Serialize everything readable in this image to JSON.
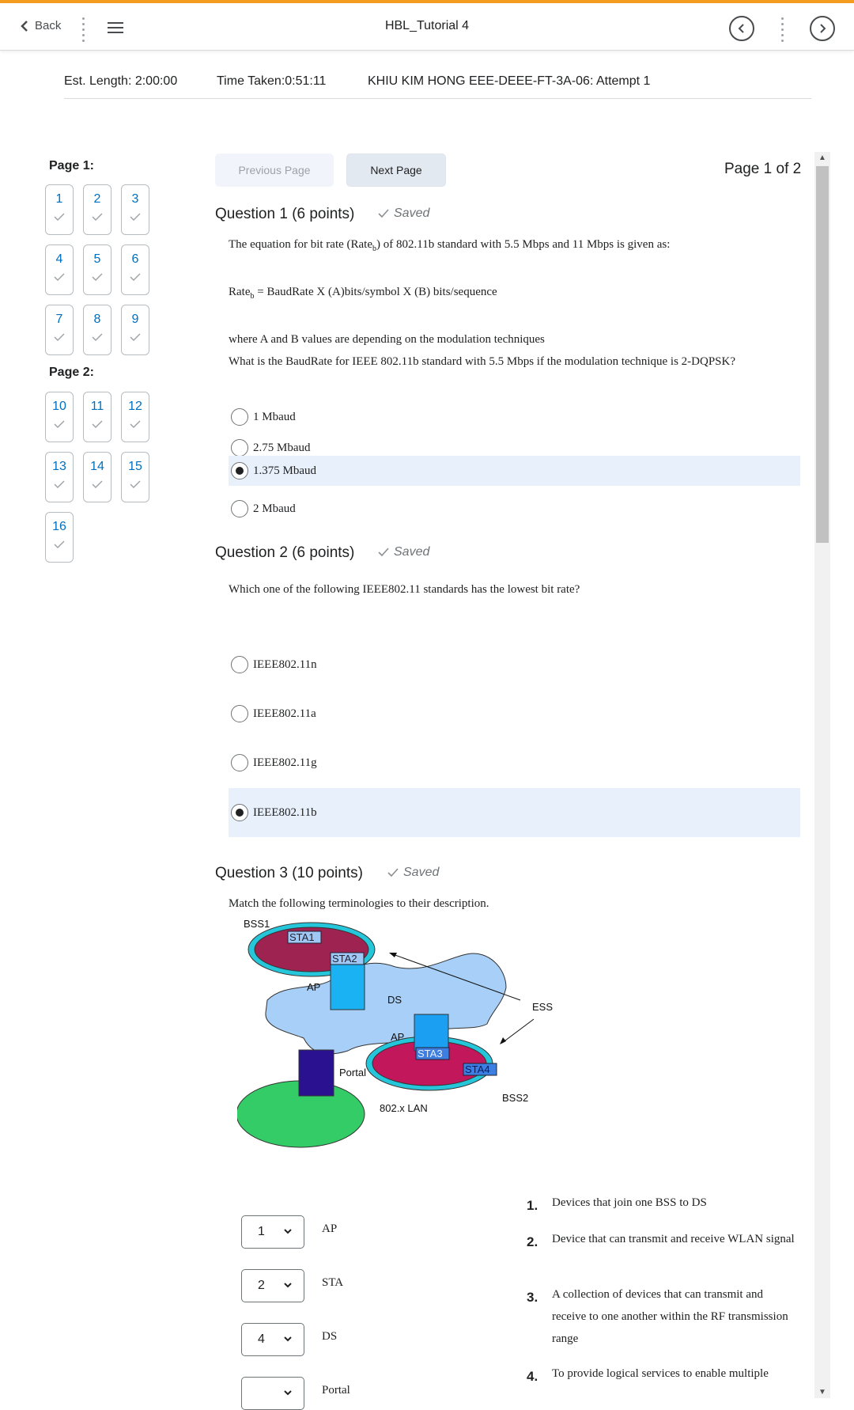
{
  "nav": {
    "back_label": "Back",
    "title": "HBL_Tutorial 4"
  },
  "info": {
    "est_length": "Est. Length: 2:00:00",
    "time_taken": "Time Taken:0:51:11",
    "attempt": "KHIU KIM HONG EEE-DEEE-FT-3A-06: Attempt 1"
  },
  "sidebar": {
    "page1_label": "Page 1:",
    "page2_label": "Page 2:",
    "page1_questions": [
      "1",
      "2",
      "3",
      "4",
      "5",
      "6",
      "7",
      "8",
      "9"
    ],
    "page2_questions": [
      "10",
      "11",
      "12",
      "13",
      "14",
      "15",
      "16"
    ]
  },
  "pager": {
    "prev_label": "Previous Page",
    "next_label": "Next Page",
    "page_of": "Page 1 of 2"
  },
  "q1": {
    "title": "Question 1",
    "points": "(6 points)",
    "saved": "Saved",
    "line1_a": "The equation for bit rate (Rate",
    "sub": "b",
    "line1_b": ") of 802.11b standard with 5.5 Mbps and 11 Mbps is given as:",
    "formula_a": "Rate",
    "formula_b": " = BaudRate X (A)bits/symbol X (B) bits/sequence",
    "line3": "where A and B values are depending on the modulation techniques",
    "line4": "What is the BaudRate for IEEE 802.11b standard with 5.5 Mbps if the modulation technique is 2-DQPSK?",
    "options": [
      "1 Mbaud",
      "2.75 Mbaud",
      "1.375 Mbaud",
      "2 Mbaud"
    ],
    "selected_index": 2
  },
  "q2": {
    "title": "Question 2",
    "points": "(6 points)",
    "saved": "Saved",
    "text": "Which one of the following IEEE802.11 standards has the lowest bit rate?",
    "options": [
      "IEEE802.11n",
      "IEEE802.11a",
      "IEEE802.11g",
      "IEEE802.11b"
    ],
    "selected_index": 3
  },
  "q3": {
    "title": "Question 3",
    "points": "(10 points)",
    "saved": "Saved",
    "text": "Match the following terminologies to their description.",
    "diagram": {
      "bss1": "BSS1",
      "sta1": "STA1",
      "sta2": "STA2",
      "ap1": "AP",
      "ds": "DS",
      "ess": "ESS",
      "ap2": "AP",
      "sta3": "STA3",
      "sta4": "STA4",
      "portal": "Portal",
      "bss2": "BSS2",
      "lan": "802.x LAN"
    },
    "matches": [
      {
        "value": "1",
        "term": "AP"
      },
      {
        "value": "2",
        "term": "STA"
      },
      {
        "value": "4",
        "term": "DS"
      },
      {
        "value": "",
        "term": "Portal"
      }
    ],
    "descriptions": [
      {
        "num": "1.",
        "text": "Devices that join one BSS to DS"
      },
      {
        "num": "2.",
        "text": "Device that can transmit and receive WLAN signal"
      },
      {
        "num": "3.",
        "text": "A collection of devices that can transmit and receive to one another within the RF transmission range"
      },
      {
        "num": "4.",
        "text": "To provide logical services to enable multiple"
      }
    ]
  },
  "colors": {
    "accent": "#f39c1f",
    "link": "#006fbf",
    "selected_bg": "#e8f1fb"
  }
}
